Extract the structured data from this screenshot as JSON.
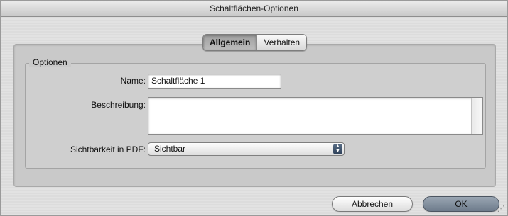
{
  "window": {
    "title": "Schaltflächen-Optionen"
  },
  "tabs": [
    {
      "label": "Allgemein",
      "active": true
    },
    {
      "label": "Verhalten",
      "active": false
    }
  ],
  "options": {
    "group_label": "Optionen",
    "name_label": "Name:",
    "name_value": "Schaltfläche 1",
    "description_label": "Beschreibung:",
    "description_value": "",
    "visibility_label": "Sichtbarkeit in PDF:",
    "visibility_value": "Sichtbar",
    "visibility_icon": "popup-arrows-icon"
  },
  "buttons": {
    "cancel": "Abbrechen",
    "ok": "OK"
  },
  "colors": {
    "default_button": "#7b8896"
  }
}
